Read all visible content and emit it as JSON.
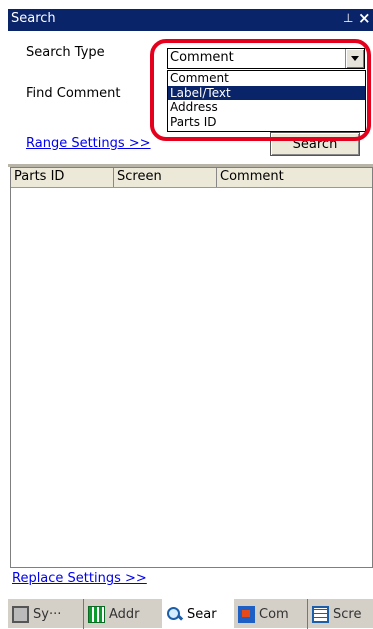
{
  "window": {
    "title": "Search",
    "pin_glyph": "⊥",
    "close_glyph": "×"
  },
  "form": {
    "search_type_label": "Search Type",
    "search_type_value": "Comment",
    "find_label": "Find Comment",
    "range_settings_link": "Range Settings >>",
    "search_button": "Search"
  },
  "dropdown": {
    "options": [
      "Comment",
      "Label/Text",
      "Address",
      "Parts ID"
    ],
    "selected_index": 1
  },
  "table": {
    "columns": [
      "Parts ID",
      "Screen",
      "Comment"
    ]
  },
  "replace_settings_link": "Replace Settings >>",
  "tabs": [
    {
      "label": "Sy···",
      "icon": "system-icon"
    },
    {
      "label": "Addr",
      "icon": "address-grid-icon"
    },
    {
      "label": "Sear",
      "icon": "search-icon",
      "active": true
    },
    {
      "label": "Com",
      "icon": "comment-icon"
    },
    {
      "label": "Scre",
      "icon": "screen-list-icon"
    }
  ],
  "colors": {
    "title_bar": "#0a246a",
    "selection": "#0a246a",
    "callout_ring": "#e5001d",
    "link": "#0000ee"
  }
}
